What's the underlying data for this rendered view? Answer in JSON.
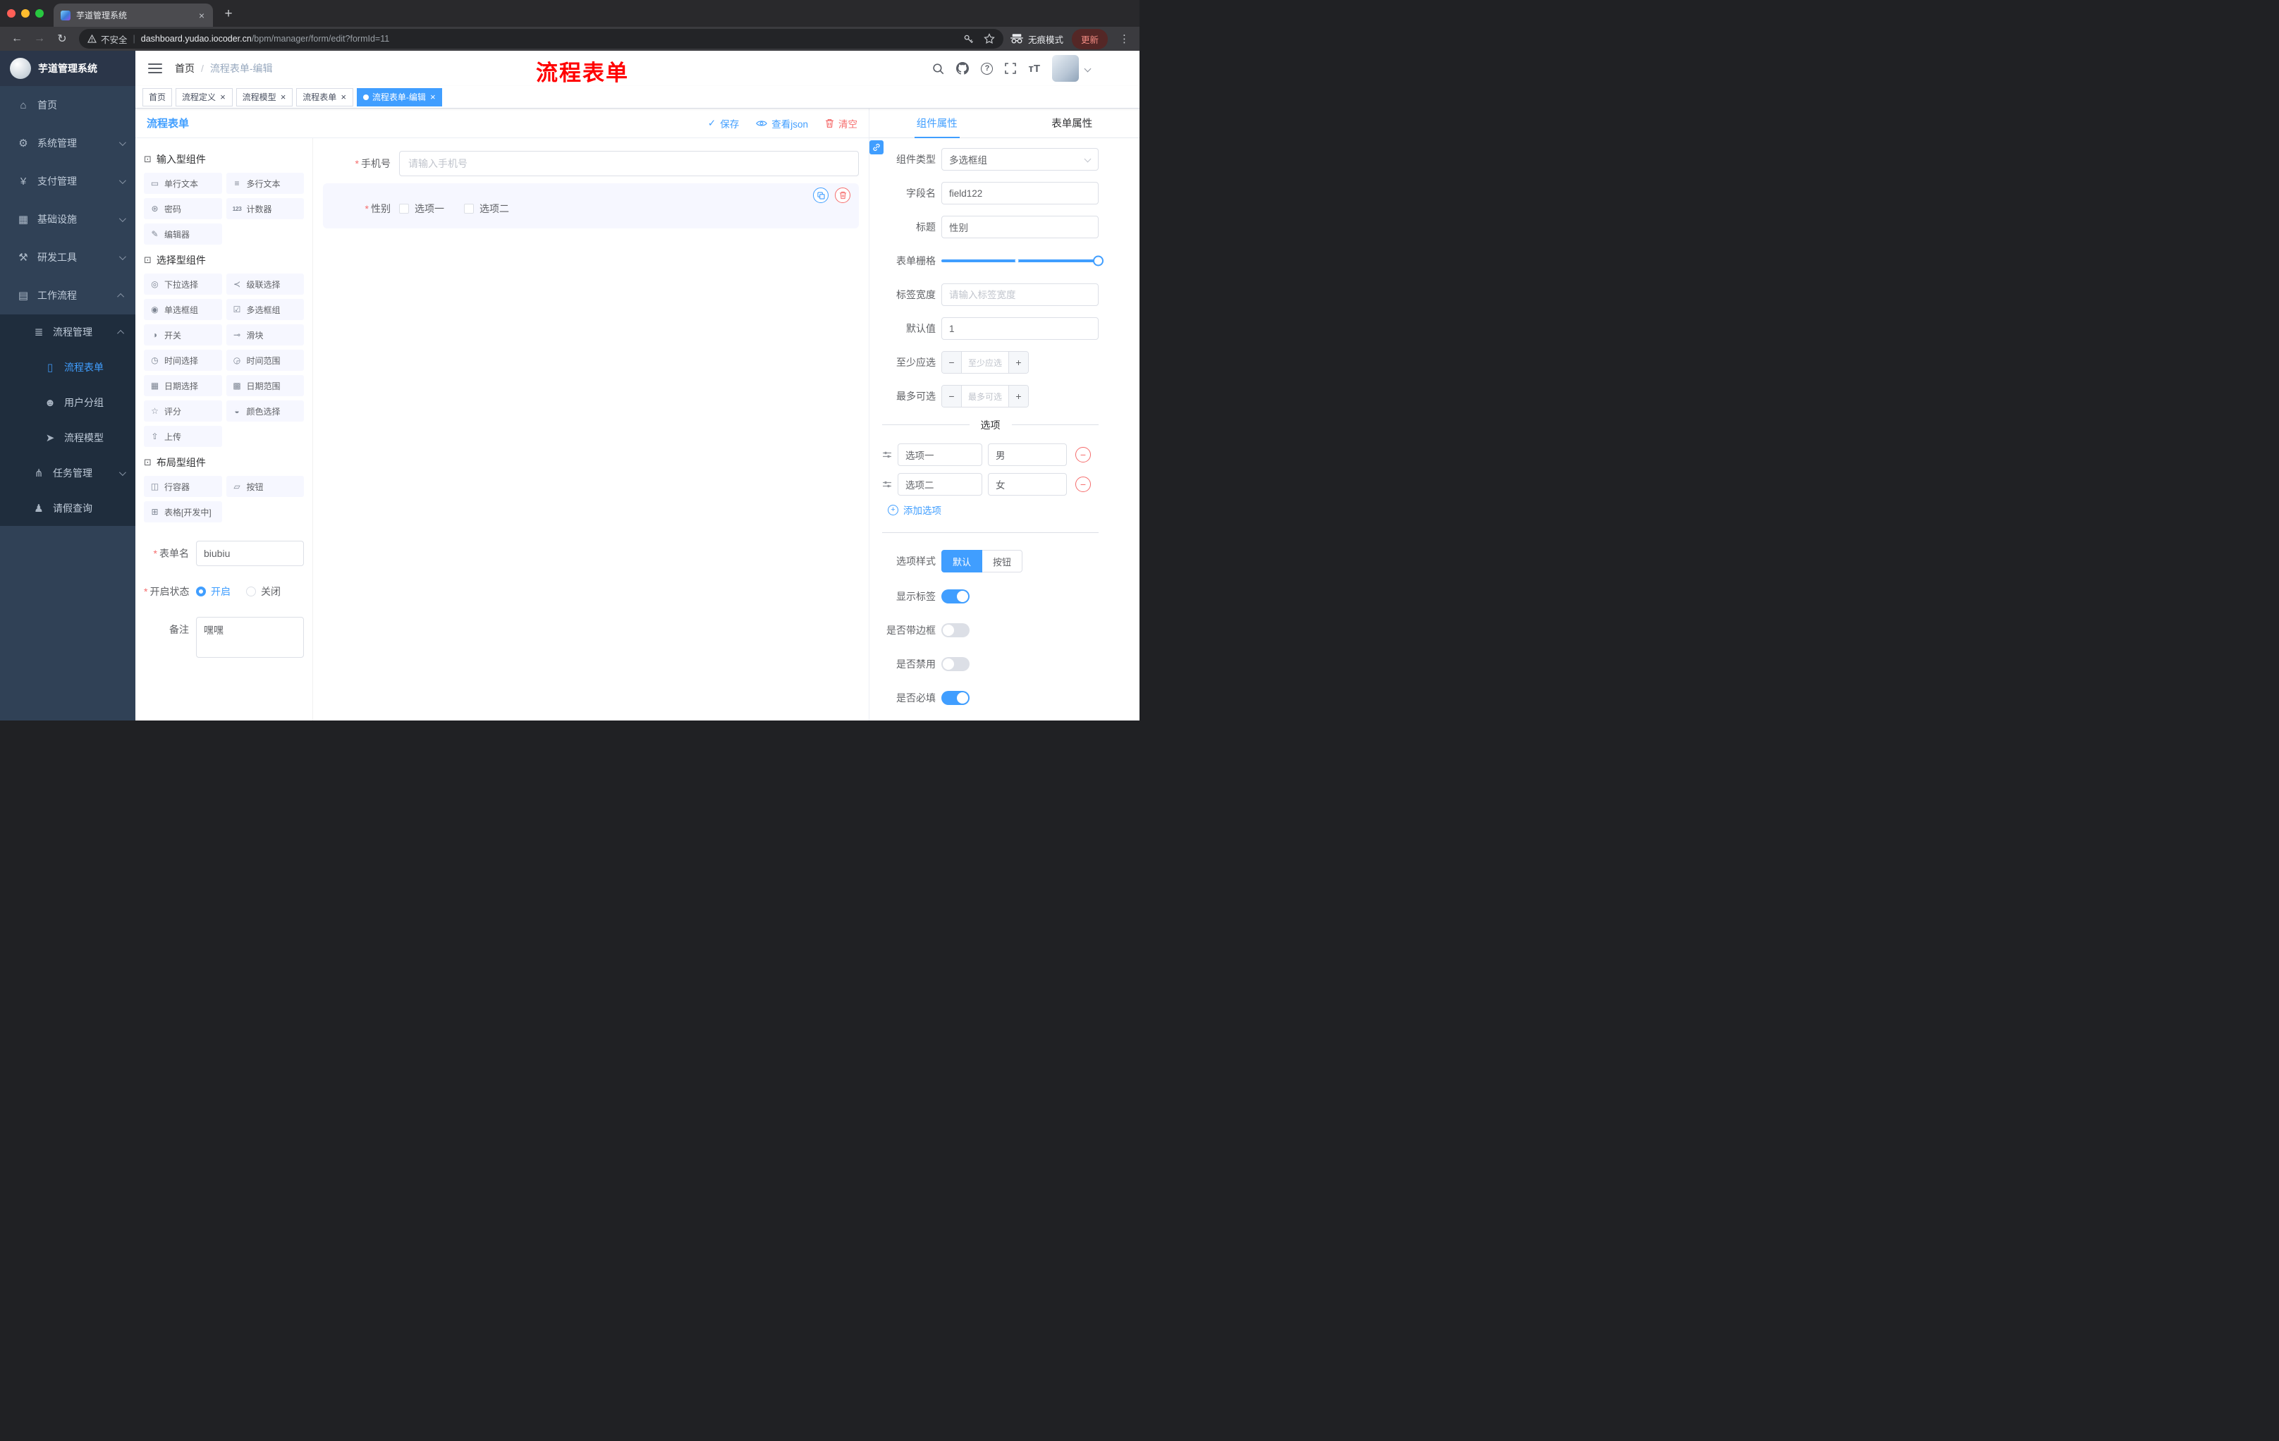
{
  "colors": {
    "accent": "#409eff",
    "danger": "#f56c6c",
    "watermark_red": "#ff0000",
    "sidebar_bg": "#304156",
    "submenu_bg": "#1f2d3d",
    "active_tag_bg": "#409eff"
  },
  "browser": {
    "tab": {
      "title": "芋道管理系统"
    },
    "security_label": "不安全",
    "url_host": "dashboard.yudao.iocoder.cn",
    "url_path": "/bpm/manager/form/edit?formId=11",
    "incognito_label": "无痕模式",
    "update_label": "更新"
  },
  "sidebar": {
    "logo_title": "芋道管理系统",
    "items": [
      {
        "id": "home",
        "label": "首页",
        "glyph": "⌂",
        "level": 0,
        "sub": false
      },
      {
        "id": "system",
        "label": "系统管理",
        "glyph": "⚙",
        "level": 0,
        "chevron": "down",
        "sub": false
      },
      {
        "id": "payment",
        "label": "支付管理",
        "glyph": "¥",
        "level": 0,
        "chevron": "down",
        "sub": false
      },
      {
        "id": "infra",
        "label": "基础设施",
        "glyph": "▦",
        "level": 0,
        "chevron": "down",
        "sub": false
      },
      {
        "id": "devtools",
        "label": "研发工具",
        "glyph": "⚒",
        "level": 0,
        "chevron": "down",
        "sub": false
      },
      {
        "id": "workflow",
        "label": "工作流程",
        "glyph": "▤",
        "level": 0,
        "chevron": "up",
        "sub": false
      },
      {
        "id": "process-mgmt",
        "label": "流程管理",
        "glyph": "≣",
        "level": 1,
        "chevron": "up",
        "sub": true
      },
      {
        "id": "process-form",
        "label": "流程表单",
        "glyph": "▯",
        "level": 2,
        "active": true,
        "sub": true
      },
      {
        "id": "user-group",
        "label": "用户分组",
        "glyph": "☻",
        "level": 2,
        "sub": true
      },
      {
        "id": "process-model",
        "label": "流程模型",
        "glyph": "➤",
        "level": 2,
        "sub": true
      },
      {
        "id": "task-mgmt",
        "label": "任务管理",
        "glyph": "⋔",
        "level": 1,
        "chevron": "down",
        "sub": true
      },
      {
        "id": "leave-query",
        "label": "请假查询",
        "glyph": "♟",
        "level": 1,
        "sub": true
      }
    ]
  },
  "header": {
    "breadcrumb": {
      "root": "首页",
      "separator": "/",
      "current": "流程表单-编辑"
    },
    "watermark": "流程表单",
    "font_size_icon_text": "тT"
  },
  "tags": [
    {
      "label": "首页",
      "closable": false,
      "active": false
    },
    {
      "label": "流程定义",
      "closable": true,
      "active": false
    },
    {
      "label": "流程模型",
      "closable": true,
      "active": false
    },
    {
      "label": "流程表单",
      "closable": true,
      "active": false
    },
    {
      "label": "流程表单-编辑",
      "closable": true,
      "active": true
    }
  ],
  "toolbar": {
    "title": "流程表单",
    "save": "保存",
    "view_json": "查看json",
    "clear": "清空"
  },
  "palette": {
    "section_icon": "⊡",
    "sections": [
      {
        "title": "输入型组件",
        "items": [
          {
            "id": "single-line-text",
            "glyph": "▭",
            "label": "单行文本"
          },
          {
            "id": "multi-line-text",
            "glyph": "≡",
            "label": "多行文本"
          },
          {
            "id": "password",
            "glyph": "⊛",
            "label": "密码"
          },
          {
            "id": "counter",
            "glyph": "123",
            "label": "计数器"
          },
          {
            "id": "editor",
            "glyph": "✎",
            "label": "编辑器"
          }
        ]
      },
      {
        "title": "选择型组件",
        "items": [
          {
            "id": "select",
            "glyph": "◎",
            "label": "下拉选择"
          },
          {
            "id": "cascader",
            "glyph": "≺",
            "label": "级联选择"
          },
          {
            "id": "radio-group",
            "glyph": "◉",
            "label": "单选框组"
          },
          {
            "id": "checkbox-group",
            "glyph": "☑",
            "label": "多选框组"
          },
          {
            "id": "switch",
            "glyph": "◑",
            "label": "开关"
          },
          {
            "id": "slider",
            "glyph": "⊸",
            "label": "滑块"
          },
          {
            "id": "time-picker",
            "glyph": "◷",
            "label": "时间选择"
          },
          {
            "id": "time-range",
            "glyph": "◶",
            "label": "时间范围"
          },
          {
            "id": "date-picker",
            "glyph": "▦",
            "label": "日期选择"
          },
          {
            "id": "date-range",
            "glyph": "▩",
            "label": "日期范围"
          },
          {
            "id": "rate",
            "glyph": "☆",
            "label": "评分"
          },
          {
            "id": "color-picker",
            "glyph": "◒",
            "label": "颜色选择"
          },
          {
            "id": "upload",
            "glyph": "⇧",
            "label": "上传"
          }
        ]
      },
      {
        "title": "布局型组件",
        "items": [
          {
            "id": "row-container",
            "glyph": "◫",
            "label": "行容器"
          },
          {
            "id": "button",
            "glyph": "▱",
            "label": "按钮"
          },
          {
            "id": "table-dev",
            "glyph": "⊞",
            "label": "表格[开发中]"
          }
        ]
      }
    ],
    "form": {
      "name_label": "表单名",
      "name_value": "biubiu",
      "status_label": "开启状态",
      "status_on": "开启",
      "status_off": "关闭",
      "status_value": "开启",
      "remark_label": "备注",
      "remark_value": "嘿嘿"
    }
  },
  "canvas": {
    "fields": [
      {
        "id": "mobile",
        "label": "手机号",
        "required": true,
        "type": "input",
        "placeholder": "请输入手机号",
        "selected": false
      },
      {
        "id": "gender",
        "label": "性别",
        "required": true,
        "type": "checkbox-group",
        "options": [
          "选项一",
          "选项二"
        ],
        "selected": true
      }
    ]
  },
  "properties": {
    "tabs": [
      {
        "label": "组件属性",
        "active": true
      },
      {
        "label": "表单属性",
        "active": false
      }
    ],
    "rows": [
      {
        "id": "component-type",
        "label": "组件类型",
        "type": "select",
        "value": "多选框组"
      },
      {
        "id": "field-name",
        "label": "字段名",
        "type": "input",
        "value": "field122"
      },
      {
        "id": "title",
        "label": "标题",
        "type": "input",
        "value": "性别"
      },
      {
        "id": "form-grid",
        "label": "表单栅格",
        "type": "slider"
      },
      {
        "id": "label-width",
        "label": "标签宽度",
        "type": "input",
        "placeholder": "请输入标签宽度"
      },
      {
        "id": "default-value",
        "label": "默认值",
        "type": "input",
        "value": "1"
      },
      {
        "id": "min-select",
        "label": "至少应选",
        "type": "stepper",
        "placeholder": "至少应选"
      },
      {
        "id": "max-select",
        "label": "最多可选",
        "type": "stepper",
        "placeholder": "最多可选"
      }
    ],
    "options_divider": "选项",
    "options": [
      {
        "label": "选项一",
        "value": "男"
      },
      {
        "label": "选项二",
        "value": "女"
      }
    ],
    "add_option": "添加选项",
    "style_row": {
      "label": "选项样式",
      "options": [
        "默认",
        "按钮"
      ],
      "active": "默认"
    },
    "switches": [
      {
        "id": "show-label",
        "label": "显示标签",
        "on": true
      },
      {
        "id": "bordered",
        "label": "是否带边框",
        "on": false
      },
      {
        "id": "disabled",
        "label": "是否禁用",
        "on": false
      },
      {
        "id": "required",
        "label": "是否必填",
        "on": true
      }
    ]
  }
}
